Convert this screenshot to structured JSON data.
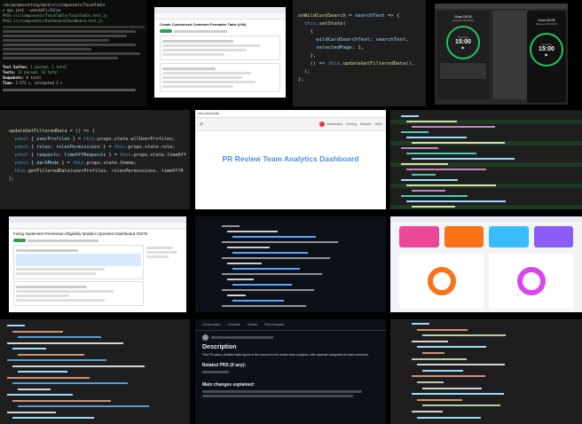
{
  "t1_terminal": {
    "lines": [
      "rdx/pm/pmssetting/dash/src/components/TouchTable",
      "> npx jest --watchAll=false",
      "PASS src/components/TouchTable/TouchTable.test.js",
      "PASS src/components/Dashboard/Dashboard.test.js"
    ],
    "summary_rows": [
      {
        "label": "Test Suites:",
        "value": "1 passed, 1 total"
      },
      {
        "label": "Tests:",
        "value": "13 passed, 13 total"
      },
      {
        "label": "Snapshots:",
        "value": "0 total"
      },
      {
        "label": "Time:",
        "value": "2.572 s, estimated 3 s"
      }
    ]
  },
  "t2_github": {
    "title": "Create Customized Comment Formatter Table (#94)"
  },
  "t3_code": {
    "lines": [
      [
        [
          "fn",
          "onWildCardSearch"
        ],
        [
          "tx",
          " = "
        ],
        [
          "vr",
          "searchText"
        ],
        [
          "tx",
          " => {"
        ]
      ],
      [
        [
          "tx",
          "  "
        ],
        [
          "bl",
          "this"
        ],
        [
          "tx",
          "."
        ],
        [
          "fn",
          "setState"
        ],
        [
          "tx",
          "("
        ]
      ],
      [
        [
          "tx",
          "    {"
        ]
      ],
      [
        [
          "tx",
          "      "
        ],
        [
          "vr",
          "wildCardSearchText"
        ],
        [
          "tx",
          ": "
        ],
        [
          "vr",
          "searchText"
        ],
        [
          "tx",
          ","
        ]
      ],
      [
        [
          "tx",
          "      "
        ],
        [
          "vr",
          "selectedPage"
        ],
        [
          "tx",
          ": "
        ],
        [
          "nm",
          "1"
        ],
        [
          "tx",
          ","
        ]
      ],
      [
        [
          "tx",
          "    },"
        ]
      ],
      [
        [
          "tx",
          "    () => "
        ],
        [
          "bl",
          "this"
        ],
        [
          "tx",
          "."
        ],
        [
          "fn",
          "updateGetFilteredData"
        ],
        [
          "tx",
          "(),"
        ]
      ],
      [
        [
          "tx",
          "  );"
        ]
      ],
      [
        [
          "tx",
          "};"
        ]
      ]
    ]
  },
  "t4_timer": {
    "left": {
      "heading": "Goal 15:00",
      "sub": "Elapsed 00:00:00",
      "time": "15:00",
      "state": "Counting"
    },
    "right": {
      "heading": "Goal 15:00",
      "sub": "Elapsed 00:00:00",
      "time": "15:00",
      "state": "Counting"
    },
    "accent": "#22c55e"
  },
  "t5_code": {
    "lines": [
      [
        [
          "fn",
          "updateGetFilteredData"
        ],
        [
          "tx",
          " = () => {"
        ]
      ],
      [
        [
          "tx",
          "  "
        ],
        [
          "bl",
          "const"
        ],
        [
          "tx",
          " { "
        ],
        [
          "vr",
          "userProfiles"
        ],
        [
          "tx",
          " } = "
        ],
        [
          "bl",
          "this"
        ],
        [
          "tx",
          ".props.state.allUserProfiles;"
        ]
      ],
      [
        [
          "tx",
          "  "
        ],
        [
          "bl",
          "const"
        ],
        [
          "tx",
          " { "
        ],
        [
          "vr",
          "roles: rolesPermissions"
        ],
        [
          "tx",
          " } = "
        ],
        [
          "bl",
          "this"
        ],
        [
          "tx",
          ".props.state.role;"
        ]
      ],
      [
        [
          "tx",
          "  "
        ],
        [
          "bl",
          "const"
        ],
        [
          "tx",
          " { "
        ],
        [
          "vr",
          "requests: timeOffRequests"
        ],
        [
          "tx",
          " } = "
        ],
        [
          "bl",
          "this"
        ],
        [
          "tx",
          ".props.state.timeOff"
        ]
      ],
      [
        [
          "tx",
          "  "
        ],
        [
          "bl",
          "const"
        ],
        [
          "tx",
          " { "
        ],
        [
          "vr",
          "darkMode"
        ],
        [
          "tx",
          " } = "
        ],
        [
          "bl",
          "this"
        ],
        [
          "tx",
          ".props.state.theme;"
        ]
      ],
      [
        [
          "tx",
          ""
        ]
      ],
      [
        [
          "tx",
          "  "
        ],
        [
          "bl",
          "this"
        ],
        [
          "tx",
          "."
        ],
        [
          "fn",
          "getFilteredData"
        ],
        [
          "tx",
          "(userProfiles, rolesPermissions, timeOffR"
        ]
      ],
      [
        [
          "tx",
          "};"
        ]
      ]
    ]
  },
  "t6_dashboard": {
    "brand": "one community",
    "nav": [
      "Dashboard",
      "Timelog",
      "Reports",
      "Other"
    ],
    "title": "PR Review Team Analytics Dashboard",
    "accent": "#1a73e8"
  },
  "t7_diff": {},
  "t8_github": {
    "title": "Fixing Implement Permission Eligibility Modal in Question Dashboard #3279"
  },
  "t9_github_dark": {},
  "t10_stats": {
    "cards": [
      {
        "color": "#ec4899"
      },
      {
        "color": "#f97316"
      },
      {
        "color": "#38bdf8"
      },
      {
        "color": "#8b5cf6"
      }
    ],
    "ring_colors": [
      "#f97316",
      "#d946ef"
    ]
  },
  "t11_ide": {},
  "t12_pr": {
    "tabs": [
      "Conversation",
      "Commits",
      "Checks",
      "Files changed"
    ],
    "heading": "Description",
    "body": "This PR adds a detailed table layout of the owners for the review team analytics, with separate categories for team members.",
    "sub_heading": "Related PRS (if any):",
    "sub_heading2": "Main changes explained:"
  },
  "t13_code": {}
}
